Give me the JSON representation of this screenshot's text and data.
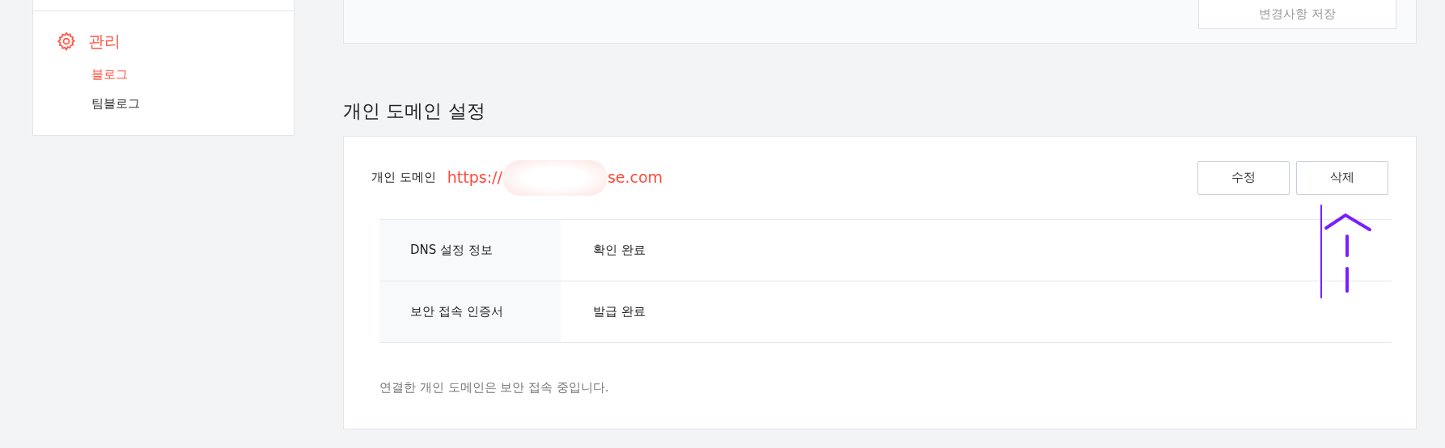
{
  "sidebar": {
    "section": {
      "title": "관리",
      "items": [
        {
          "label": "블로그",
          "selected": true
        },
        {
          "label": "팀블로그",
          "selected": false
        }
      ]
    }
  },
  "top_card": {
    "save_button": "변경사항 저장"
  },
  "domain_section": {
    "heading": "개인 도메인 설정",
    "domain_label": "개인 도메인",
    "url_start": "https://",
    "url_end": "se.com",
    "buttons": [
      "수정",
      "삭제"
    ],
    "rows": [
      {
        "label": "DNS 설정 정보",
        "value": "확인 완료"
      },
      {
        "label": "보안 접속 인증서",
        "value": "발급 완료"
      }
    ],
    "note": "연결한 개인 도메인은 보안 접속 중입니다."
  }
}
